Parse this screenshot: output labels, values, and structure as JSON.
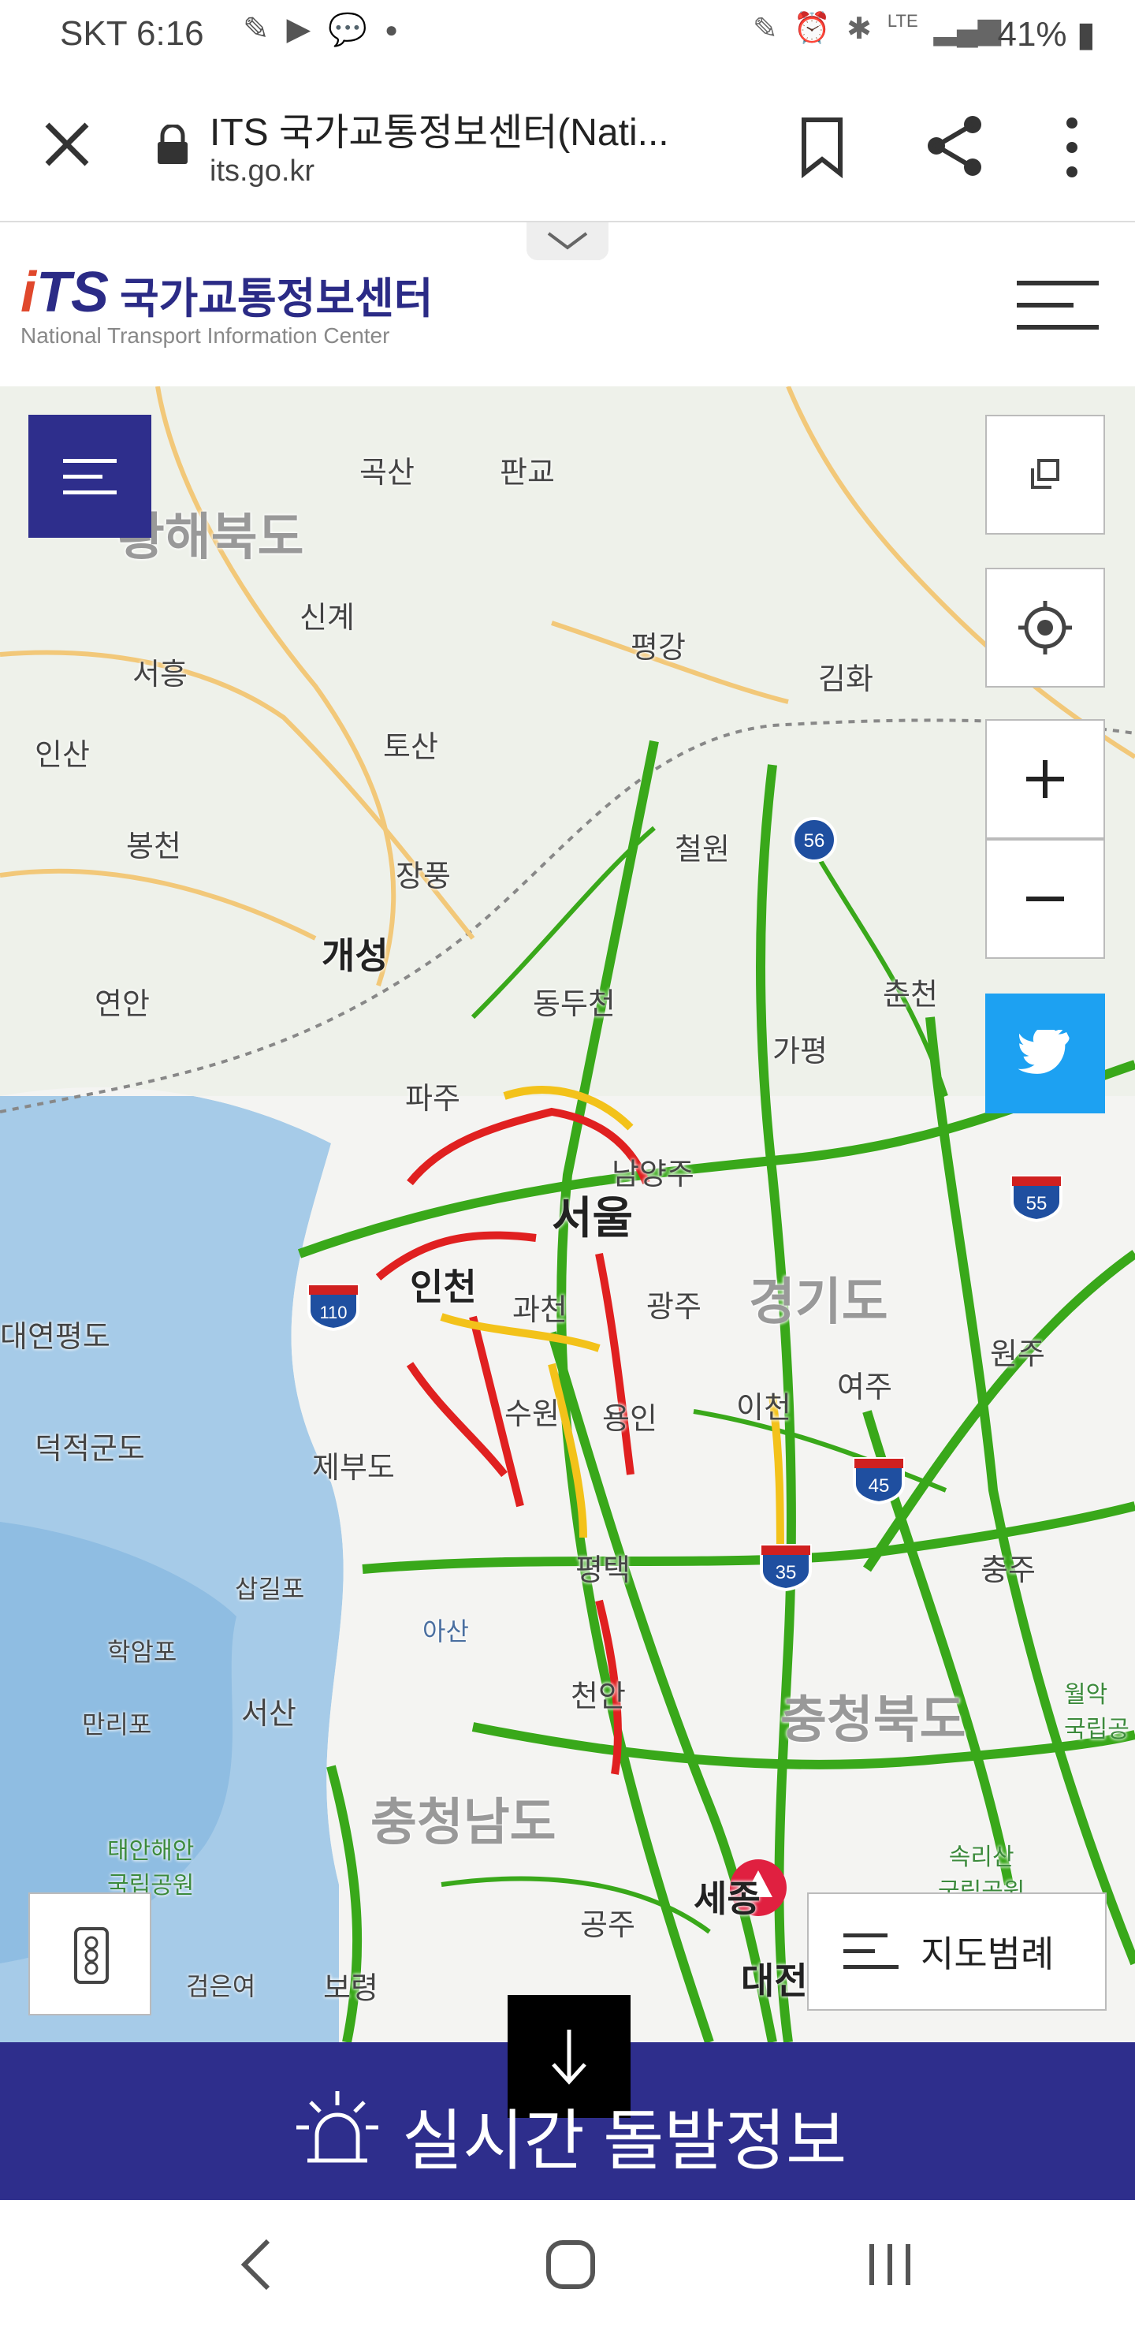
{
  "status_bar": {
    "carrier_time": "SKT 6:16",
    "notification_icons": [
      "feather-icon",
      "youtube-icon",
      "talk-icon",
      "dot-icon"
    ],
    "system_icons": [
      "pen-icon",
      "alarm-icon",
      "bluetooth-icon",
      "lte-icon",
      "signal-icon"
    ],
    "battery": "41%"
  },
  "browser": {
    "title": "ITS 국가교통정보센터(Nati...",
    "url": "its.go.kr"
  },
  "site": {
    "logo_text": "iTS",
    "logo_kr": "국가교통정보센터",
    "logo_en": "National Transport Information Center"
  },
  "map": {
    "regions": [
      "황해북도",
      "경기도",
      "충청북도",
      "충청남도"
    ],
    "labels": {
      "gok_san": "곡산",
      "pan_gyo": "판교",
      "sin_gye": "신계",
      "pyeong_gang": "평강",
      "seo_heung": "서흥",
      "gim_hwa": "김화",
      "in_san": "인산",
      "to_san": "토산",
      "cheol_won": "철원",
      "bong_cheon": "봉천",
      "jang_pung": "장풍",
      "gae_seong": "개성",
      "yeon_an": "연안",
      "dong_du_cheon": "동두천",
      "chun_cheon": "춘천",
      "ga_pyeong": "가평",
      "pa_ju": "파주",
      "nam_yang_ju": "남양주",
      "seoul": "서울",
      "incheon": "인천",
      "gwa_cheon": "과천",
      "gwang_ju": "광주",
      "won_ju": "원주",
      "yeo_ju": "여주",
      "i_cheon": "이천",
      "su_won": "수원",
      "yong_in": "용인",
      "dae_yeon_pyeong": "대연평도",
      "deok_jeok": "덕적군도",
      "je_bu": "제부도",
      "pyeong_taek": "평택",
      "chung_ju": "충주",
      "sap_gyo": "삽길포",
      "a_san": "아산",
      "hak_am": "학암포",
      "seo_san": "서산",
      "cheon_an": "천안",
      "man_ri": "만리포",
      "taean_park": "태안해안\n국립공원",
      "wol_ak": "월악\n국립공",
      "sori_san": "속리산\n국립공원",
      "gong_ju": "공주",
      "se_jong": "세종",
      "geom_eun": "검은여",
      "bo_ryeong": "보령",
      "dae_jeon": "대전"
    },
    "highways": [
      "110",
      "56",
      "55",
      "45",
      "35"
    ],
    "legend_label": "지도범례"
  },
  "banner": {
    "text": "실시간 돌발정보"
  }
}
